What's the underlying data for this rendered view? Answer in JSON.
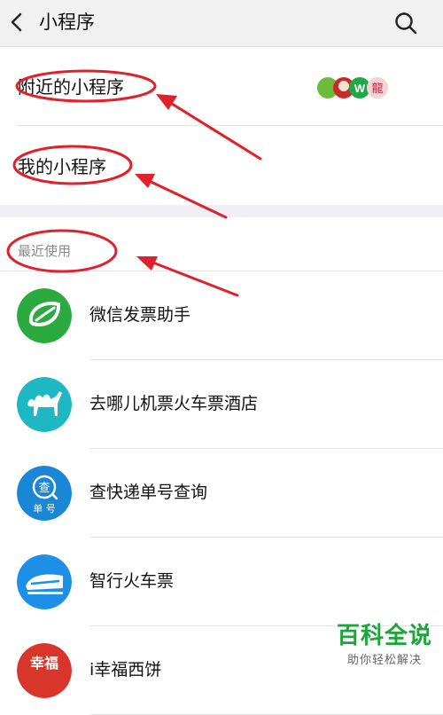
{
  "header": {
    "title": "小程序"
  },
  "nearby": {
    "label": "附近的小程序",
    "icon_text": "龍"
  },
  "mine": {
    "label": "我的小程序"
  },
  "recent": {
    "section_title": "最近使用"
  },
  "apps": [
    {
      "name": "微信发票助手",
      "color": "#2bab3f"
    },
    {
      "name": "去哪儿机票火车票酒店",
      "color": "#1eb7c4"
    },
    {
      "name": "查快递单号查询",
      "color": "#1a86d6",
      "icon_lines": [
        "查",
        "单 号"
      ]
    },
    {
      "name": "智行火车票",
      "color": "#1e8fe6"
    },
    {
      "name": "i幸福西饼",
      "color": "#d9362b",
      "icon_lines": [
        "幸福"
      ]
    }
  ],
  "watermark": {
    "title": "百科全说",
    "subtitle": "助你轻松解决"
  },
  "colors": {
    "annotation_red": "#e0202a",
    "header_bg": "#f1f1f1",
    "section_gap": "#efeff4"
  }
}
